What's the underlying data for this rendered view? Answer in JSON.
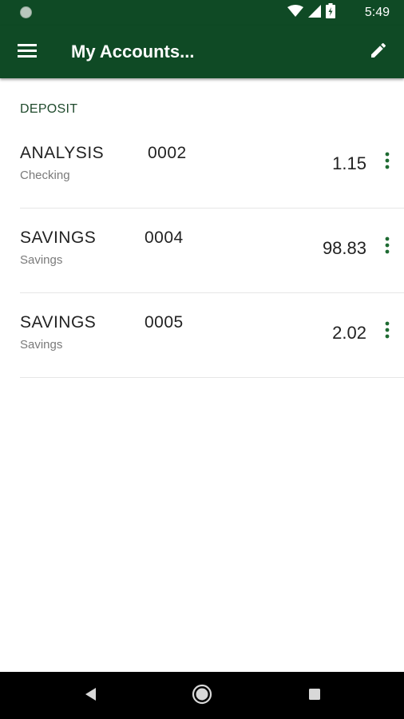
{
  "status_bar": {
    "time": "5:49",
    "icons": [
      "notification-dot-icon",
      "wifi-icon",
      "cell-signal-icon",
      "battery-icon"
    ]
  },
  "toolbar": {
    "title": "My Accounts...",
    "menu_icon": "hamburger-menu-icon",
    "edit_icon": "pencil-icon"
  },
  "section": {
    "label": "DEPOSIT"
  },
  "accounts": [
    {
      "name": "ANALYSIS",
      "number": "0002",
      "type": "Checking",
      "balance": "1.15"
    },
    {
      "name": "SAVINGS",
      "number": "0004",
      "type": "Savings",
      "balance": "98.83"
    },
    {
      "name": "SAVINGS",
      "number": "0005",
      "type": "Savings",
      "balance": "2.02"
    }
  ],
  "nav_bar": {
    "icons": [
      "back-icon",
      "home-icon",
      "recents-icon"
    ]
  },
  "colors": {
    "brand": "#0f4a25",
    "accent": "#1e6b32"
  }
}
